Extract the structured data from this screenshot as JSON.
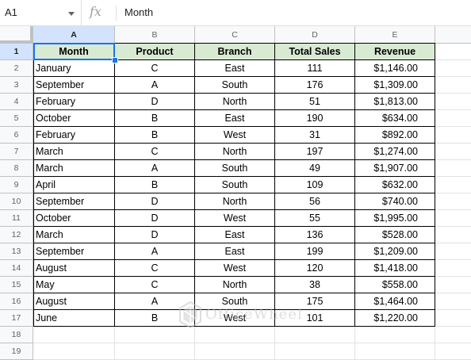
{
  "formula_bar": {
    "name_box": "A1",
    "fx_label": "fx",
    "content": "Month"
  },
  "columns": [
    "A",
    "B",
    "C",
    "D",
    "E"
  ],
  "rows": [
    "1",
    "2",
    "3",
    "4",
    "5",
    "6",
    "7",
    "8",
    "9",
    "10",
    "11",
    "12",
    "13",
    "14",
    "15",
    "16",
    "17",
    "18",
    "19"
  ],
  "table": {
    "headers": [
      "Month",
      "Product",
      "Branch",
      "Total Sales",
      "Revenue"
    ],
    "records": [
      [
        "January",
        "C",
        "East",
        "111",
        "$1,146.00"
      ],
      [
        "September",
        "A",
        "South",
        "176",
        "$1,309.00"
      ],
      [
        "February",
        "D",
        "North",
        "51",
        "$1,813.00"
      ],
      [
        "October",
        "B",
        "East",
        "190",
        "$634.00"
      ],
      [
        "February",
        "B",
        "West",
        "31",
        "$892.00"
      ],
      [
        "March",
        "C",
        "North",
        "197",
        "$1,274.00"
      ],
      [
        "March",
        "A",
        "South",
        "49",
        "$1,907.00"
      ],
      [
        "April",
        "B",
        "South",
        "109",
        "$632.00"
      ],
      [
        "September",
        "D",
        "North",
        "56",
        "$740.00"
      ],
      [
        "October",
        "D",
        "West",
        "55",
        "$1,995.00"
      ],
      [
        "March",
        "D",
        "East",
        "136",
        "$528.00"
      ],
      [
        "September",
        "A",
        "East",
        "199",
        "$1,209.00"
      ],
      [
        "August",
        "C",
        "West",
        "120",
        "$1,418.00"
      ],
      [
        "May",
        "C",
        "North",
        "38",
        "$558.00"
      ],
      [
        "August",
        "A",
        "South",
        "175",
        "$1,464.00"
      ],
      [
        "June",
        "B",
        "West",
        "101",
        "$1,220.00"
      ]
    ]
  },
  "watermark": {
    "text": "OfficeWheel",
    "icon": "officewheel-logo-icon"
  },
  "colors": {
    "header_fill": "#d9ead3",
    "selection": "#1a73e8",
    "selected_header": "#d3e3fd"
  }
}
